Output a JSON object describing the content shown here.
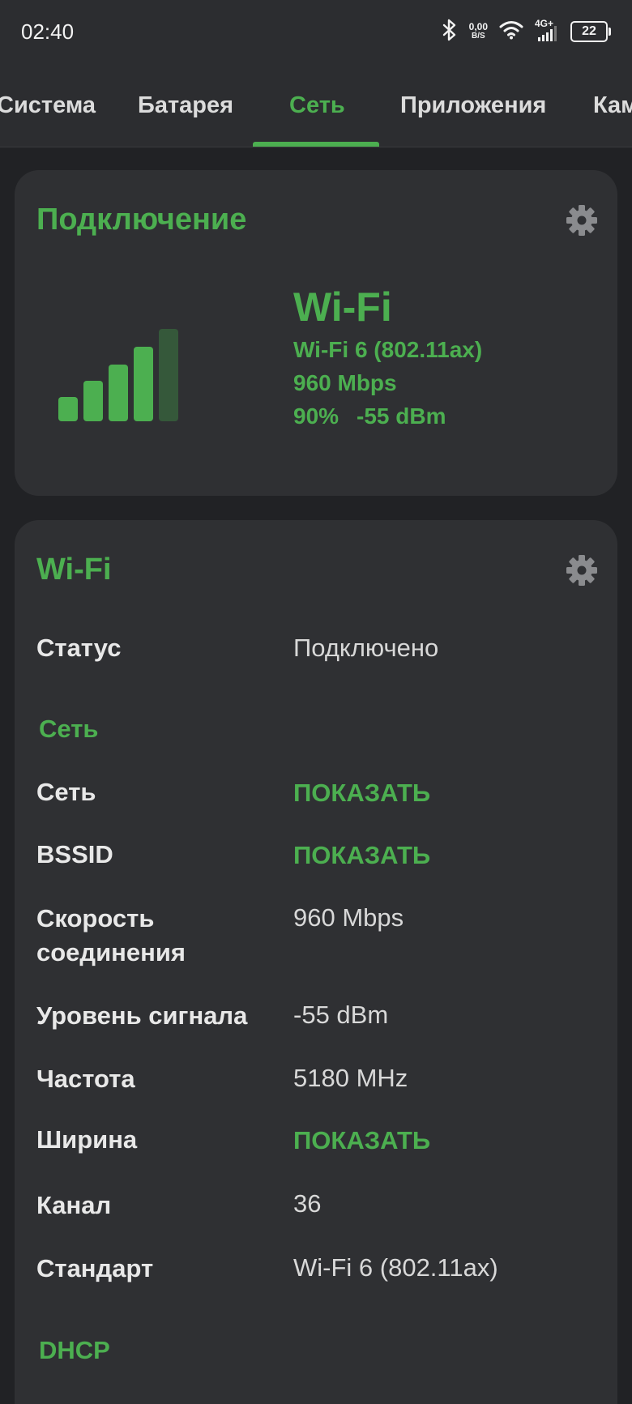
{
  "status_bar": {
    "time": "02:40",
    "net_speed_value": "0,00",
    "net_speed_unit": "B/S",
    "mobile_type": "4G+",
    "battery": "22",
    "icons": [
      "bluetooth-icon",
      "wifi-icon",
      "cell-signal-icon",
      "battery-icon"
    ]
  },
  "tabs": {
    "items": [
      "Система",
      "Батарея",
      "Сеть",
      "Приложения",
      "Кам"
    ],
    "active_index": 2
  },
  "connection_card": {
    "title": "Подключение",
    "type": "Wi-Fi",
    "standard": "Wi-Fi 6 (802.11ax)",
    "speed": "960 Mbps",
    "signal_percent": "90%",
    "signal_dbm": "-55 dBm",
    "signal_bars_filled": 4,
    "signal_bars_total": 5
  },
  "wifi_card": {
    "title": "Wi-Fi",
    "status_label": "Статус",
    "status_value": "Подключено",
    "section_network": "Сеть",
    "rows": [
      {
        "label": "Сеть",
        "value": "ПОКАЗАТЬ"
      },
      {
        "label": "BSSID",
        "value": "ПОКАЗАТЬ"
      },
      {
        "label": "Скорость соединения",
        "value": "960 Mbps"
      },
      {
        "label": "Уровень сигнала",
        "value": "-55 dBm"
      },
      {
        "label": "Частота",
        "value": "5180 MHz"
      },
      {
        "label": "Ширина",
        "value": "ПОКАЗАТЬ"
      },
      {
        "label": "Канал",
        "value": "36"
      },
      {
        "label": "Стандарт",
        "value": "Wi-Fi 6 (802.11ax)"
      }
    ],
    "section_dhcp": "DHCP"
  },
  "colors": {
    "accent": "#4caf50",
    "background": "#212225",
    "card": "#2f3033"
  }
}
